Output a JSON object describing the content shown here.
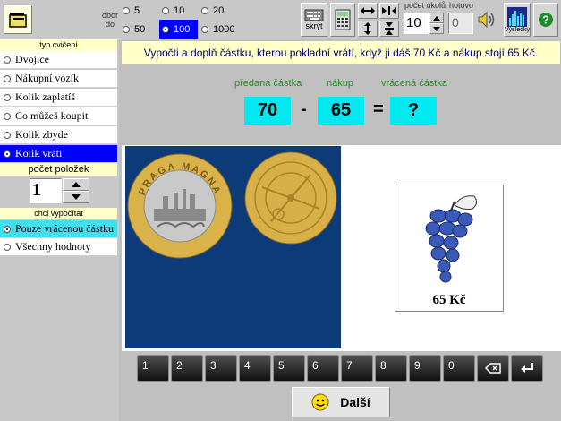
{
  "toolbar": {
    "range_label_line1": "obor",
    "range_label_line2": "do",
    "ranges": [
      "5",
      "10",
      "20",
      "50",
      "100",
      "1000"
    ],
    "selected_range": "100",
    "hide_label": "skrýt",
    "count_label": "počet úkolů",
    "count_value": "10",
    "done_label": "hotovo",
    "done_value": "0",
    "results_label": "Výsledky"
  },
  "left": {
    "type_header": "typ cvičení",
    "types": [
      "Dvojice",
      "Nákupní vozík",
      "Kolik zaplatíš",
      "Co můžeš koupit",
      "Kolik zbyde",
      "Kolik vrátí"
    ],
    "selected_type": "Kolik vrátí",
    "items_header": "počet položek",
    "items_value": "1",
    "calc_header": "chci vypočítat",
    "calc_options": [
      "Pouze vrácenou částku",
      "Všechny hodnoty"
    ],
    "selected_calc": "Pouze vrácenou částku"
  },
  "task": {
    "text": "Vypočti a doplň částku, kterou pokladní vrátí, když ji dáš 70 Kč a nákup stojí 65 Kč."
  },
  "equation": {
    "label_given": "předaná částka",
    "label_purchase": "nákup",
    "label_returned": "vrácená částka",
    "given": "70",
    "op_minus": "-",
    "purchase": "65",
    "op_equals": "=",
    "returned": "?"
  },
  "coins": {
    "coin1_text": "PRAGA MAGNA"
  },
  "product": {
    "price": "65 Kč"
  },
  "keypad": {
    "keys": [
      "1",
      "2",
      "3",
      "4",
      "5",
      "6",
      "7",
      "8",
      "9",
      "0"
    ]
  },
  "next_label": "Další",
  "colors": {
    "selection": "#0000ff",
    "cyan": "#00e8f0",
    "header_bg": "#ffffc8",
    "coin_bg": "#0d3a78",
    "label_green": "#2a8a2a"
  }
}
